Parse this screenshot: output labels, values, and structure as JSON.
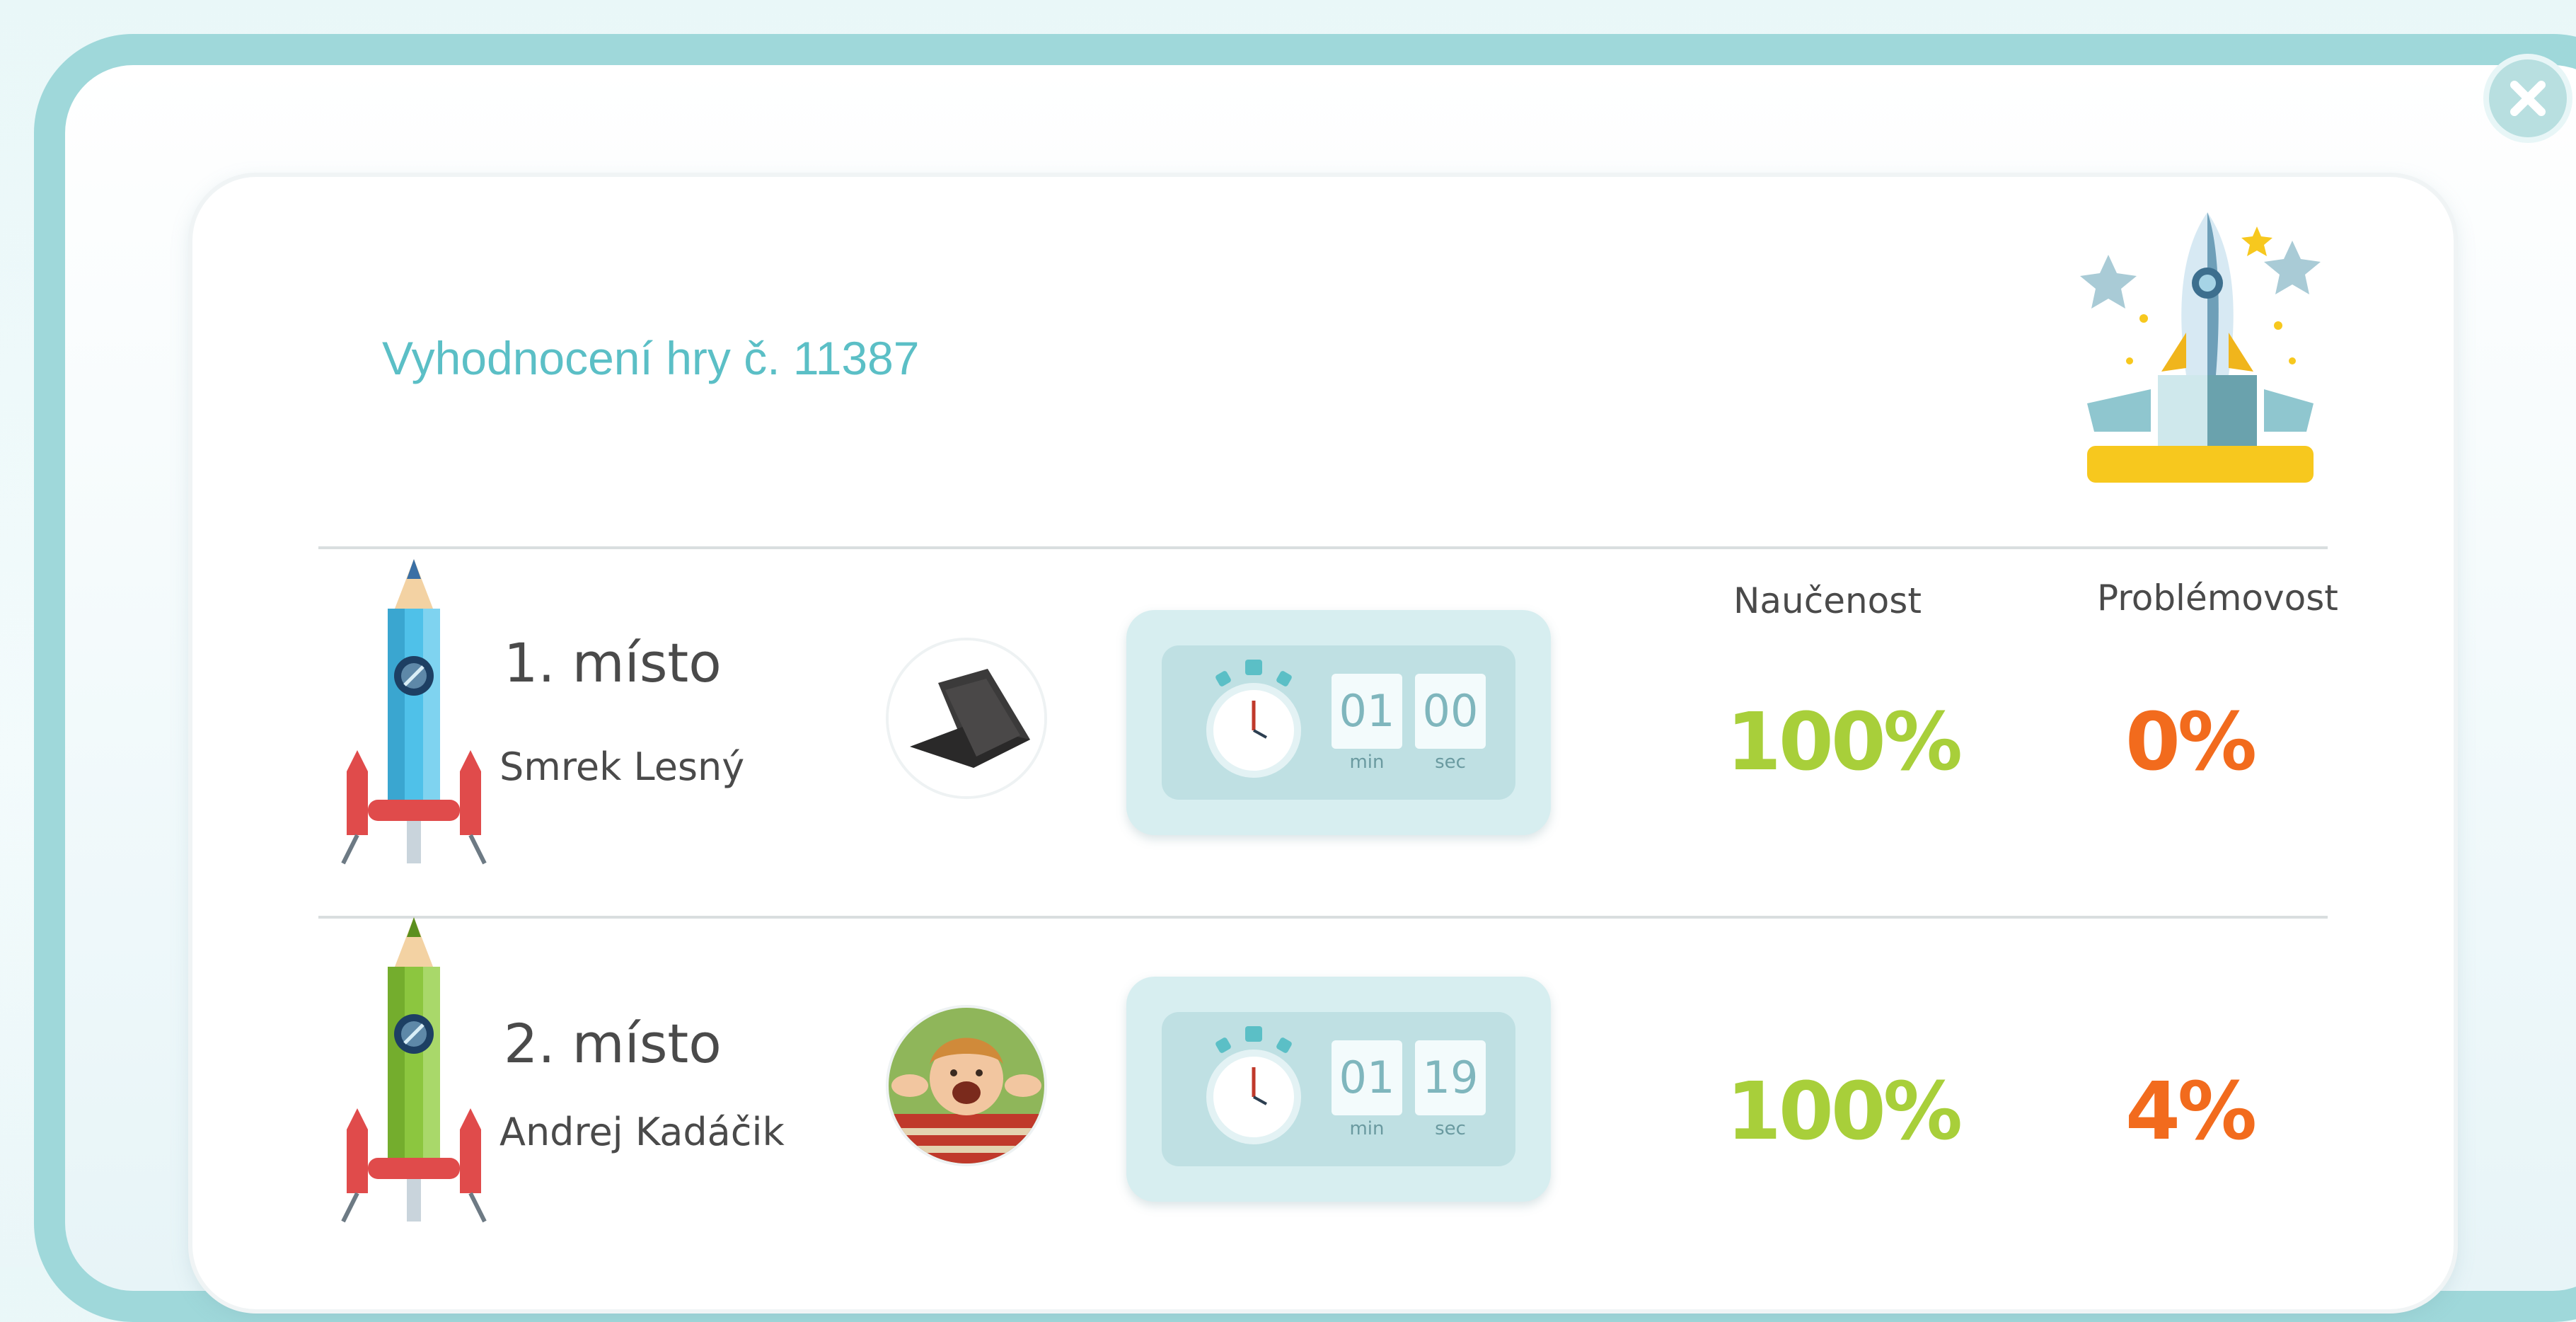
{
  "window": {
    "close_icon": "close-x-icon"
  },
  "header": {
    "title": "Vyhodnocení hry č. 11387",
    "trophy_icon": "rocket-trophy-icon"
  },
  "columns": {
    "learned": "Naučenost",
    "problems": "Problémovost"
  },
  "rows": [
    {
      "place": "1. místo",
      "name": "Smrek Lesný",
      "rocket_color": "#4fc1e9",
      "avatar": "laptop-avatar",
      "time_min": "01",
      "time_sec": "00",
      "min_label": "min",
      "sec_label": "sec",
      "learned": "100%",
      "problems": "0%"
    },
    {
      "place": "2. místo",
      "name": "Andrej Kadáčik",
      "rocket_color": "#8cc63f",
      "avatar": "child-avatar",
      "time_min": "01",
      "time_sec": "19",
      "min_label": "min",
      "sec_label": "sec",
      "learned": "100%",
      "problems": "4%"
    }
  ],
  "colors": {
    "accent": "#5bbfc6",
    "frame": "#9fd8da",
    "learned": "#a8cf3a",
    "problems": "#f26b1d"
  }
}
